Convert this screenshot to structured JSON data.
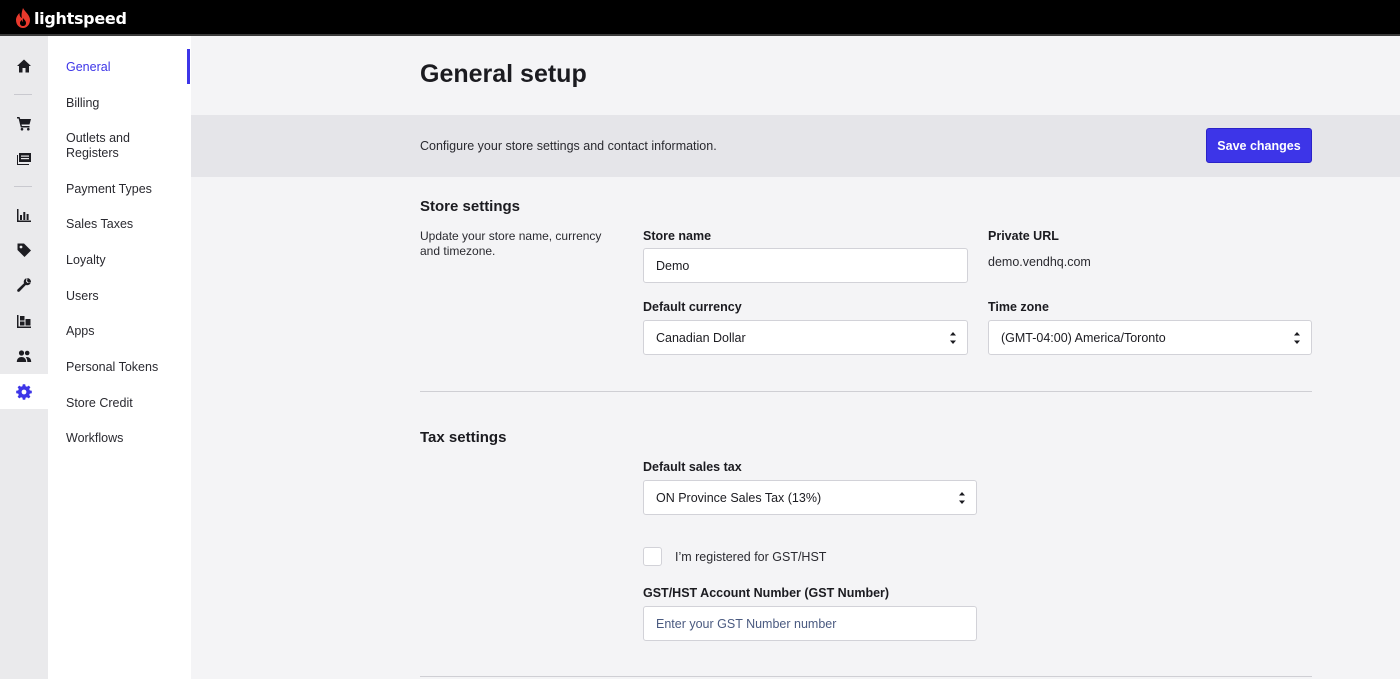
{
  "brand": {
    "name": "lightspeed"
  },
  "rail": {
    "items": [
      {
        "icon": "home-icon"
      },
      {
        "icon": "cart-icon"
      },
      {
        "icon": "sales-ledger-icon"
      },
      {
        "icon": "reporting-icon"
      },
      {
        "icon": "tag-icon"
      },
      {
        "icon": "wrench-icon"
      },
      {
        "icon": "inventory-icon"
      },
      {
        "icon": "customers-icon"
      },
      {
        "icon": "gear-icon",
        "active": true
      }
    ]
  },
  "subnav": {
    "items": [
      {
        "label": "General",
        "active": true
      },
      {
        "label": "Billing"
      },
      {
        "label": "Outlets and Registers"
      },
      {
        "label": "Payment Types"
      },
      {
        "label": "Sales Taxes"
      },
      {
        "label": "Loyalty"
      },
      {
        "label": "Users"
      },
      {
        "label": "Apps"
      },
      {
        "label": "Personal Tokens"
      },
      {
        "label": "Store Credit"
      },
      {
        "label": "Workflows"
      }
    ]
  },
  "page": {
    "title": "General setup",
    "banner_text": "Configure your store settings and contact information.",
    "save_label": "Save changes"
  },
  "store_settings": {
    "title": "Store settings",
    "description": "Update your store name, currency and timezone.",
    "store_name_label": "Store name",
    "store_name_value": "Demo",
    "private_url_label": "Private URL",
    "private_url_value": "demo.vendhq.com",
    "currency_label": "Default currency",
    "currency_value": "Canadian Dollar",
    "timezone_label": "Time zone",
    "timezone_value": "(GMT-04:00) America/Toronto"
  },
  "tax_settings": {
    "title": "Tax settings",
    "default_tax_label": "Default sales tax",
    "default_tax_value": "ON Province Sales Tax (13%)",
    "gst_checkbox_label": "I’m registered for GST/HST",
    "gst_checked": false,
    "gst_number_label": "GST/HST Account Number (GST Number)",
    "gst_number_placeholder": "Enter your GST Number number",
    "gst_number_value": ""
  },
  "colors": {
    "accent": "#3d35e8",
    "topbar": "#000000",
    "logo_red": "#e8392c"
  }
}
